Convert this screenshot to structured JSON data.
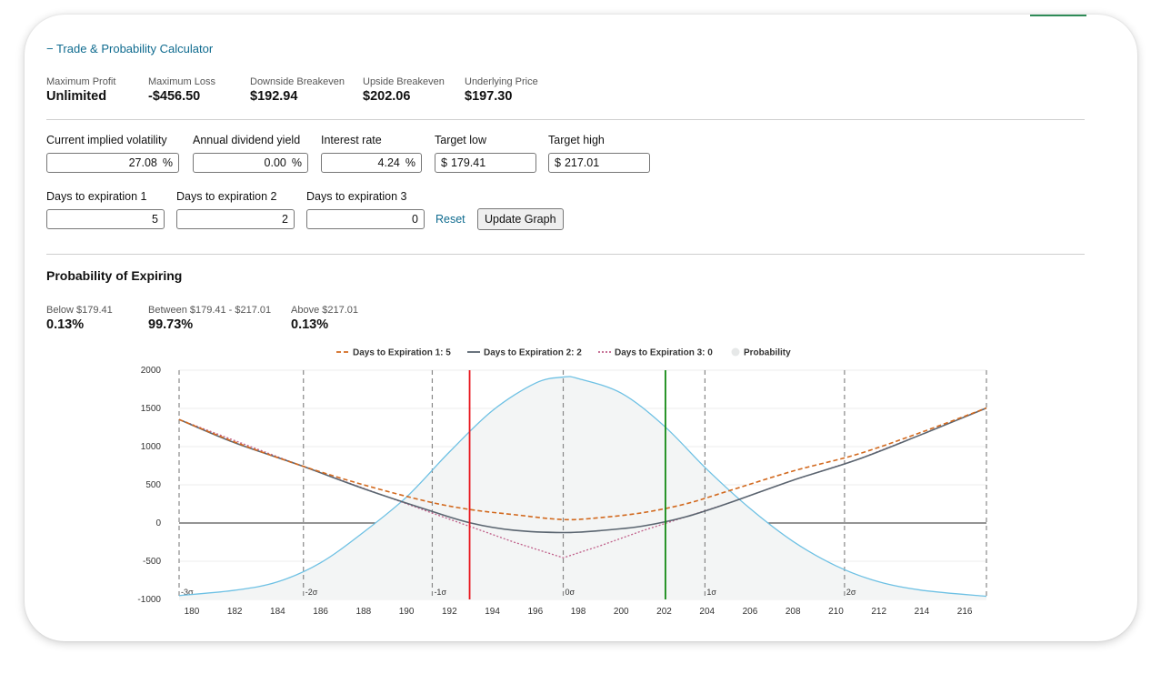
{
  "calculator": {
    "title": "− Trade & Probability Calculator"
  },
  "stats": [
    {
      "label": "Maximum Profit",
      "value": "Unlimited"
    },
    {
      "label": "Maximum Loss",
      "value": "-$456.50"
    },
    {
      "label": "Downside Breakeven",
      "value": "$192.94"
    },
    {
      "label": "Upside Breakeven",
      "value": "$202.06"
    },
    {
      "label": "Underlying Price",
      "value": "$197.30"
    }
  ],
  "inputs": {
    "volatility": {
      "label": "Current implied volatility",
      "value": "27.08",
      "unit": "%"
    },
    "dividend": {
      "label": "Annual dividend yield",
      "value": "0.00",
      "unit": "%"
    },
    "interest": {
      "label": "Interest rate",
      "value": "4.24",
      "unit": "%"
    },
    "target_low": {
      "label": "Target low",
      "prefix": "$",
      "value": "179.41"
    },
    "target_high": {
      "label": "Target high",
      "prefix": "$",
      "value": "217.01"
    },
    "dte1": {
      "label": "Days to expiration 1",
      "value": "5"
    },
    "dte2": {
      "label": "Days to expiration 2",
      "value": "2"
    },
    "dte3": {
      "label": "Days to expiration 3",
      "value": "0"
    }
  },
  "actions": {
    "reset": "Reset",
    "update": "Update Graph"
  },
  "probability": {
    "title": "Probability of Expiring",
    "items": [
      {
        "label": "Below $179.41",
        "value": "0.13%"
      },
      {
        "label": "Between $179.41 - $217.01",
        "value": "99.73%"
      },
      {
        "label": "Above $217.01",
        "value": "0.13%"
      }
    ]
  },
  "colors": {
    "dte1": "#d2691e",
    "dte2": "#5a6570",
    "dte3": "#c0608a",
    "probability": "#6ec1e4",
    "probability_fill": "#f3f5f5",
    "breakeven_low": "#e8141c",
    "breakeven_high": "#138a13",
    "link": "#0f6b8f"
  },
  "chart_data": {
    "type": "line",
    "legend_position": "top",
    "grid": true,
    "xlim": [
      179.41,
      217.01
    ],
    "ylim": [
      -1000,
      2000
    ],
    "xticks": [
      180,
      182,
      184,
      186,
      188,
      190,
      192,
      194,
      196,
      198,
      200,
      202,
      204,
      206,
      208,
      210,
      212,
      214,
      216
    ],
    "yticks": [
      -1000,
      -500,
      0,
      500,
      1000,
      1500,
      2000
    ],
    "underlying": 197.3,
    "breakevens": [
      192.94,
      202.06
    ],
    "sigma_lines": [
      {
        "label": "-3σ",
        "x": 179.41
      },
      {
        "label": "-2σ",
        "x": 185.2
      },
      {
        "label": "-1σ",
        "x": 191.2
      },
      {
        "label": "0σ",
        "x": 197.3
      },
      {
        "label": "1σ",
        "x": 203.9
      },
      {
        "label": "2σ",
        "x": 210.4
      },
      {
        "label": "",
        "x": 217.01
      }
    ],
    "series": [
      {
        "name": "Days to Expiration 1: 5",
        "x": [
          179.41,
          182,
          185,
          188,
          191,
          193,
          195,
          197.3,
          199,
          201,
          203,
          205,
          208,
          211,
          214,
          217.01
        ],
        "y": [
          1355,
          1060,
          760,
          500,
          280,
          175,
          110,
          45,
          70,
          135,
          250,
          420,
          680,
          900,
          1190,
          1505
        ]
      },
      {
        "name": "Days to Expiration 2: 2",
        "x": [
          179.41,
          182,
          185,
          188,
          191,
          193,
          195,
          197.3,
          199,
          201,
          203,
          205,
          208,
          211,
          214,
          217.01
        ],
        "y": [
          1355,
          1050,
          760,
          450,
          170,
          0,
          -95,
          -125,
          -100,
          -40,
          80,
          260,
          560,
          830,
          1160,
          1505
        ]
      },
      {
        "name": "Days to Expiration 3: 0",
        "x": [
          179.41,
          185,
          191,
          193,
          195,
          197.3,
          199,
          201,
          203,
          205,
          208,
          211,
          214,
          217.01
        ],
        "y": [
          1355,
          760,
          150,
          -50,
          -250,
          -455,
          -300,
          -100,
          80,
          260,
          560,
          830,
          1160,
          1505
        ]
      },
      {
        "name": "Probability",
        "x": [
          179.41,
          182,
          184,
          186,
          188,
          190,
          192,
          194,
          196,
          197.3,
          198,
          200,
          202,
          204,
          206,
          208,
          210,
          212,
          214,
          217.01
        ],
        "y": [
          -950,
          -880,
          -770,
          -520,
          -120,
          340,
          930,
          1470,
          1830,
          1910,
          1890,
          1700,
          1270,
          700,
          190,
          -240,
          -560,
          -770,
          -880,
          -960
        ]
      }
    ]
  }
}
